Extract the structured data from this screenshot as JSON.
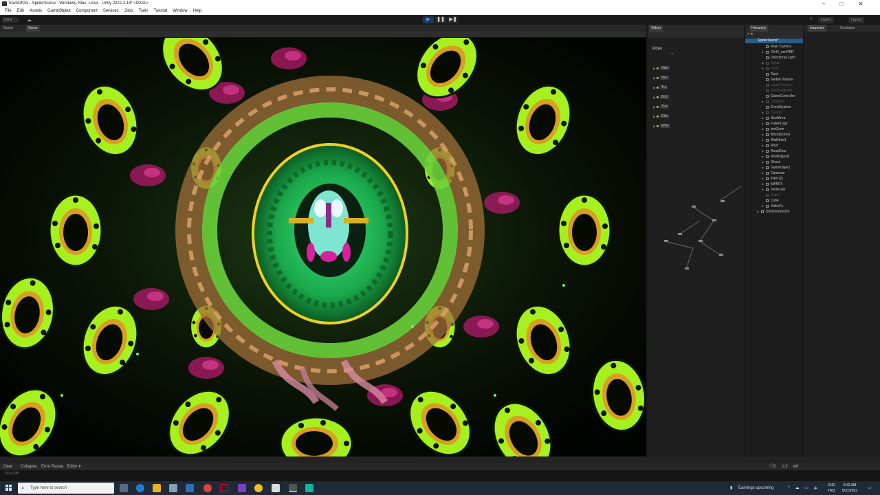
{
  "window": {
    "title": "TownOfOci - SpiderScene - Windows, Mac, Linux - Unity 2022.2.19* <DX11>",
    "controls": {
      "minimize": "–",
      "maximize": "□",
      "close": "✕"
    }
  },
  "menu": [
    "File",
    "Edit",
    "Assets",
    "GameObject",
    "Component",
    "Services",
    "Jobs",
    "Tools",
    "Tutorial",
    "Window",
    "Help"
  ],
  "toolbar": {
    "account": "CO ▾",
    "cloud_icon": "cloud-icon",
    "play_icons": {
      "play": "▶",
      "pause": "❚❚",
      "step": "▶❚"
    },
    "layers": "Layers",
    "layout": "Layout"
  },
  "tabs": {
    "scene": "Scene",
    "game": "Game",
    "video": "Videor",
    "hierarchy": "Hierarchy",
    "inspector": "Inspector",
    "occlusion": "Occlusion"
  },
  "video_panel": {
    "label": "Video",
    "plus": "+",
    "items": [
      "Vide",
      "Sku",
      "Tru",
      "Bod",
      "Trai",
      "Cho",
      "Whe"
    ]
  },
  "hierarchy": {
    "root": "SpiderScene*",
    "items": [
      {
        "name": "Main Camera",
        "dim": false
      },
      {
        "name": "Ch44_nonPBR",
        "dim": false
      },
      {
        "name": "Directional Light",
        "dim": false
      },
      {
        "name": "Spider",
        "dim": true
      },
      {
        "name": "Town",
        "dim": true
      },
      {
        "name": "Dust",
        "dim": false
      },
      {
        "name": "Global Volume",
        "dim": false
      },
      {
        "name": "Local Volume",
        "dim": true
      },
      {
        "name": "FinishingPoint",
        "dim": true
      },
      {
        "name": "GameController",
        "dim": false
      },
      {
        "name": "Droppers",
        "dim": true
      },
      {
        "name": "EventSystem",
        "dim": false
      },
      {
        "name": "Canvas",
        "dim": true
      },
      {
        "name": "SkullArea",
        "dim": false
      },
      {
        "name": "FallenLogs",
        "dim": false
      },
      {
        "name": "testZone",
        "dim": false
      },
      {
        "name": "BloodyStone",
        "dim": false
      },
      {
        "name": "WallHole1",
        "dim": false
      },
      {
        "name": "Roof",
        "dim": false
      },
      {
        "name": "RoopDoor",
        "dim": false
      },
      {
        "name": "RoofObjects",
        "dim": false
      },
      {
        "name": "Ghost",
        "dim": false
      },
      {
        "name": "GameObject",
        "dim": false
      },
      {
        "name": "Cameras",
        "dim": false
      },
      {
        "name": "Path (2)",
        "dim": false
      },
      {
        "name": "MANFX",
        "dim": false
      },
      {
        "name": "Tentecals",
        "dim": false
      },
      {
        "name": "Plane",
        "dim": true
      },
      {
        "name": "Cube",
        "dim": false
      },
      {
        "name": "VideoFx",
        "dim": false
      }
    ],
    "dont_destroy": "DontDestroyOn"
  },
  "console": {
    "clear": "Clear",
    "collapse": "Collapse",
    "error_pause": "Error Pause",
    "editor": "Editor ▾",
    "log_count": "2",
    "warn_count": "2",
    "error_count": "0"
  },
  "status": {
    "resolution": "720x1280"
  },
  "taskbar": {
    "search_placeholder": "Type here to search",
    "news": "Earnings upcoming",
    "lang": "ENG",
    "locale": "TRQ",
    "time": "8:32 AM",
    "date": "5/31/2023"
  },
  "colors": {
    "accent_blue": "#2c5d87",
    "play_active": "#5aa0ff",
    "neon_green": "#9be61c",
    "magenta": "#b0206a"
  }
}
